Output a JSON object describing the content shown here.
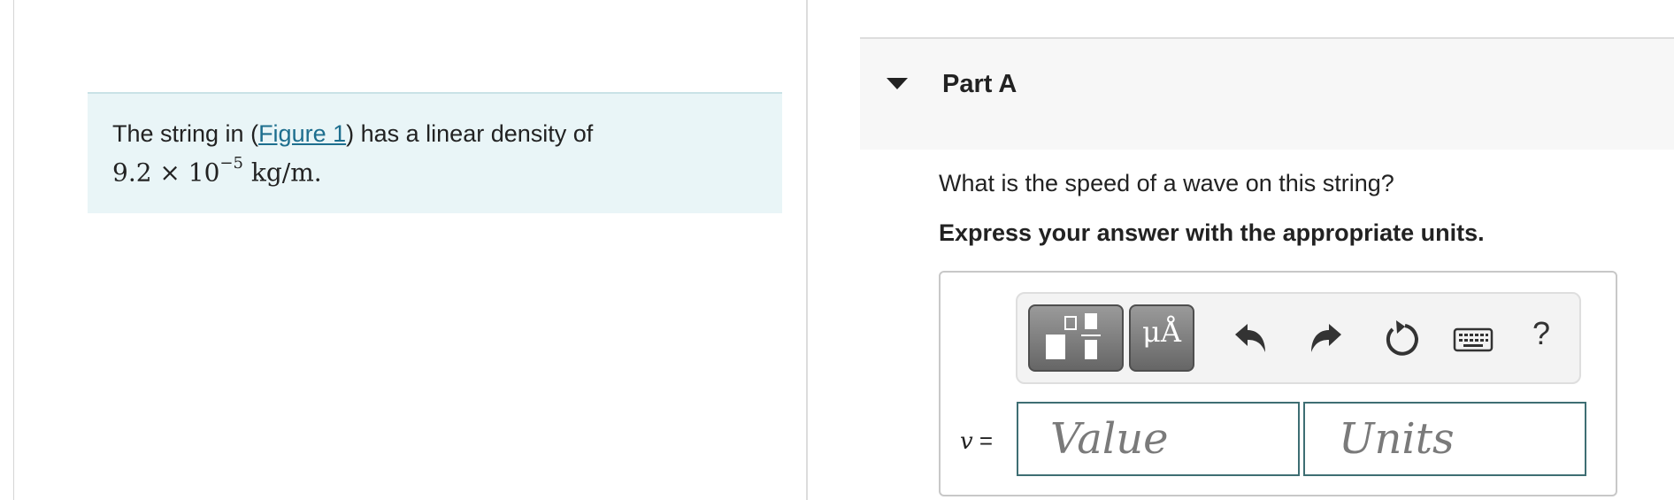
{
  "problem": {
    "text_before": "The string in (",
    "figure_link": "Figure 1",
    "text_after": ") has a linear density of",
    "density_mantissa": "9.2 × 10",
    "density_exponent": "−5",
    "density_units": " kg/m."
  },
  "part": {
    "title": "Part A",
    "question": "What is the speed of a wave on this string?",
    "instructions": "Express your answer with the appropriate units."
  },
  "toolbar": {
    "units_glyph": "μÅ",
    "help": "?"
  },
  "answer": {
    "variable": "v",
    "equals": " =",
    "value_placeholder": "Value",
    "units_placeholder": "Units"
  }
}
